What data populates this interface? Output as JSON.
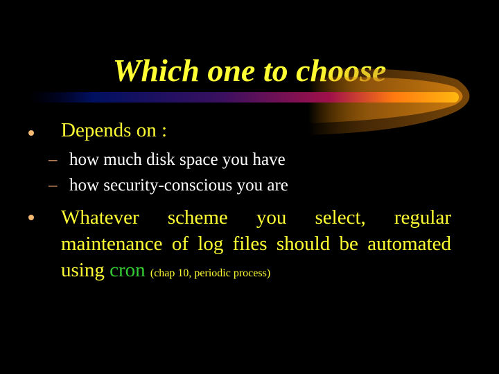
{
  "slide": {
    "title": "Which one to choose",
    "bullets": [
      {
        "text": "Depends on :",
        "subitems": [
          "how much disk space you have",
          "how security-conscious you are"
        ]
      },
      {
        "text_before": "Whatever scheme you select, regular maintenance of log files should be automated using",
        "highlight": "cron",
        "note": "(chap 10, periodic process)"
      }
    ],
    "sub_marker": "–",
    "colors": {
      "background": "#000000",
      "title": "#ffff33",
      "bullet_text": "#ffff33",
      "subitem_text": "#ffffff",
      "highlight": "#33cc33",
      "bullet_dot": "#f5b870"
    }
  }
}
